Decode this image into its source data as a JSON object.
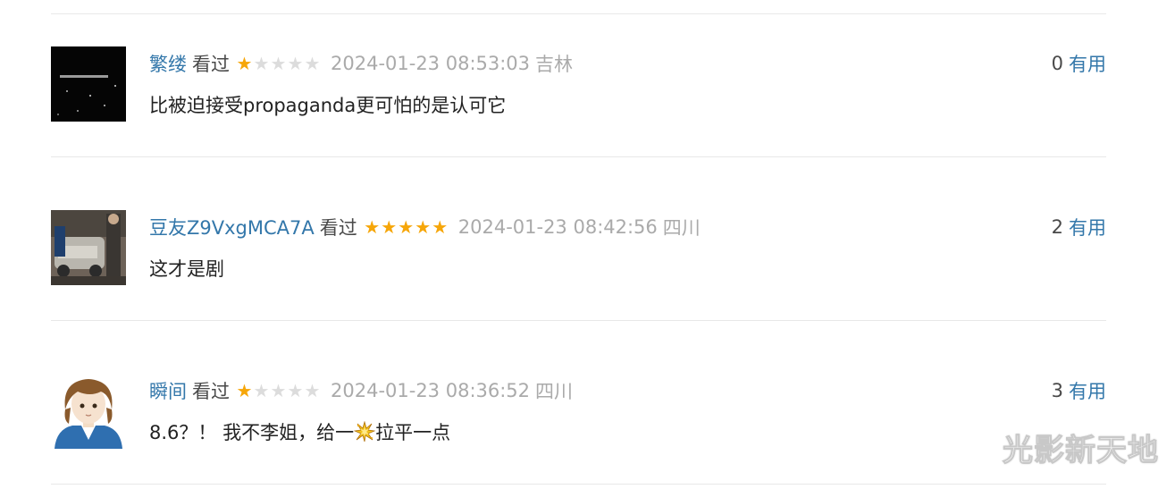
{
  "comments": [
    {
      "user": "繁缕",
      "status": "看过",
      "rating": 1,
      "time": "2024-01-23 08:53:03",
      "location": "吉林",
      "votes": "0",
      "vote_label": "有用",
      "text": "比被迫接受propaganda更可怕的是认可它"
    },
    {
      "user": "豆友Z9VxgMCA7A",
      "status": "看过",
      "rating": 5,
      "time": "2024-01-23 08:42:56",
      "location": "四川",
      "votes": "2",
      "vote_label": "有用",
      "text": "这才是剧"
    },
    {
      "user": "瞬间",
      "status": "看过",
      "rating": 1,
      "time": "2024-01-23 08:36:52",
      "location": "四川",
      "votes": "3",
      "vote_label": "有用",
      "text_before": "8.6？！ 我不李姐，给一",
      "text_after": "拉平一点",
      "emoji": "explosion-emoji"
    }
  ],
  "star_on": "★",
  "star_off": "★",
  "colors": {
    "link": "#3377aa",
    "star_on": "#f6a609",
    "star_off": "#dcdcdc",
    "meta": "#aaaaaa"
  },
  "watermark": "光影新天地"
}
